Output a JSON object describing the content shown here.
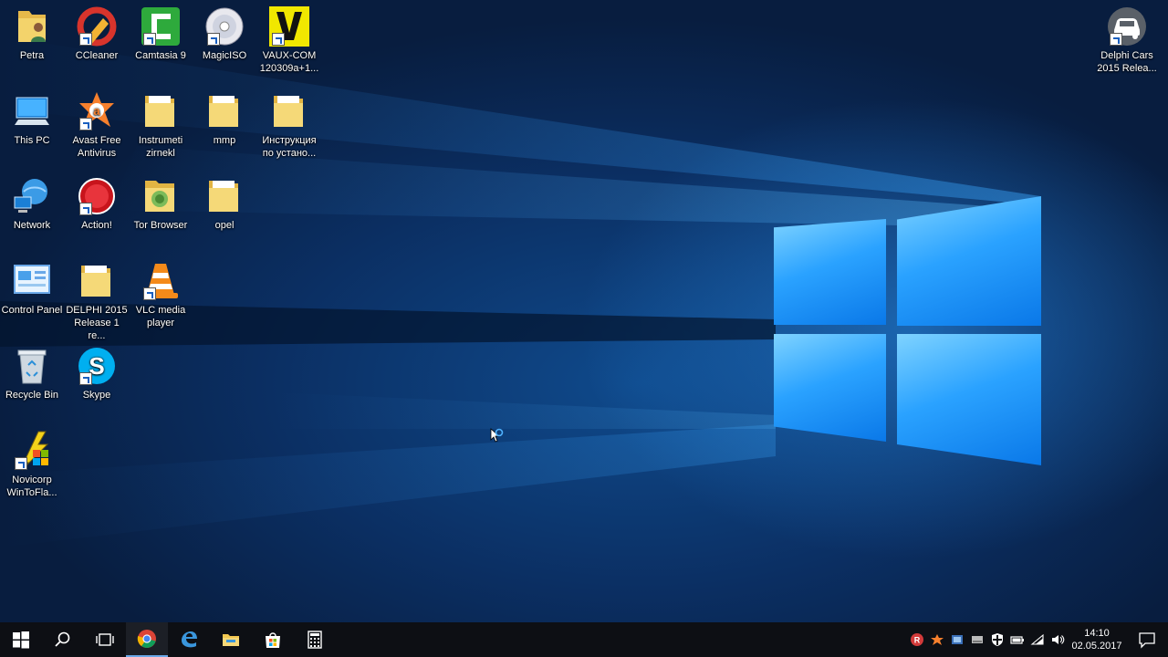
{
  "desktop": {
    "icons": [
      {
        "id": "petra",
        "label": "Petra",
        "icon": "user-folder-icon"
      },
      {
        "id": "ccleaner",
        "label": "CCleaner",
        "icon": "ccleaner-icon"
      },
      {
        "id": "camtasia",
        "label": "Camtasia 9",
        "icon": "camtasia-icon"
      },
      {
        "id": "magiciso",
        "label": "MagicISO",
        "icon": "disc-icon"
      },
      {
        "id": "vauxcom",
        "label": "VAUX-COM 120309a+1...",
        "icon": "vaux-icon"
      },
      {
        "id": "thispc",
        "label": "This PC",
        "icon": "computer-icon"
      },
      {
        "id": "avast",
        "label": "Avast Free Antivirus",
        "icon": "avast-icon"
      },
      {
        "id": "instrumeti",
        "label": "Instrumeti zirnekl",
        "icon": "folder-icon"
      },
      {
        "id": "mmp",
        "label": "mmp",
        "icon": "folder-icon"
      },
      {
        "id": "instrukciya",
        "label": "Инструкция по устано...",
        "icon": "folder-icon"
      },
      {
        "id": "network",
        "label": "Network",
        "icon": "network-icon"
      },
      {
        "id": "action",
        "label": "Action!",
        "icon": "action-icon"
      },
      {
        "id": "tor",
        "label": "Tor Browser",
        "icon": "tor-folder-icon"
      },
      {
        "id": "opel",
        "label": "opel",
        "icon": "folder-icon"
      },
      {
        "id": "controlpanel",
        "label": "Control Panel",
        "icon": "control-panel-icon"
      },
      {
        "id": "delphi2015",
        "label": "DELPHI 2015 Release 1 re...",
        "icon": "folder-icon"
      },
      {
        "id": "vlc",
        "label": "VLC media player",
        "icon": "vlc-icon"
      },
      {
        "id": "recyclebin",
        "label": "Recycle Bin",
        "icon": "recycle-bin-icon"
      },
      {
        "id": "skype",
        "label": "Skype",
        "icon": "skype-icon"
      },
      {
        "id": "novicorp",
        "label": "Novicorp WinToFla...",
        "icon": "wintoflash-icon"
      },
      {
        "id": "delphicars",
        "label": "Delphi Cars 2015 Relea...",
        "icon": "car-icon"
      }
    ]
  },
  "taskbar": {
    "buttons": [
      {
        "name": "start-button",
        "icon": "windows-logo-icon"
      },
      {
        "name": "search-button",
        "icon": "search-icon"
      },
      {
        "name": "task-view-button",
        "icon": "task-view-icon"
      },
      {
        "name": "chrome-button",
        "icon": "chrome-icon"
      },
      {
        "name": "edge-button",
        "icon": "edge-icon"
      },
      {
        "name": "file-explorer-button",
        "icon": "folder-icon"
      },
      {
        "name": "store-button",
        "icon": "store-icon"
      },
      {
        "name": "calculator-button",
        "icon": "calculator-icon"
      }
    ],
    "clock": {
      "time": "14:10",
      "date": "02.05.2017"
    }
  },
  "colors": {
    "taskbar": "#0d0f14",
    "accent": "#1e90ff",
    "folder": "#f3d36b"
  }
}
